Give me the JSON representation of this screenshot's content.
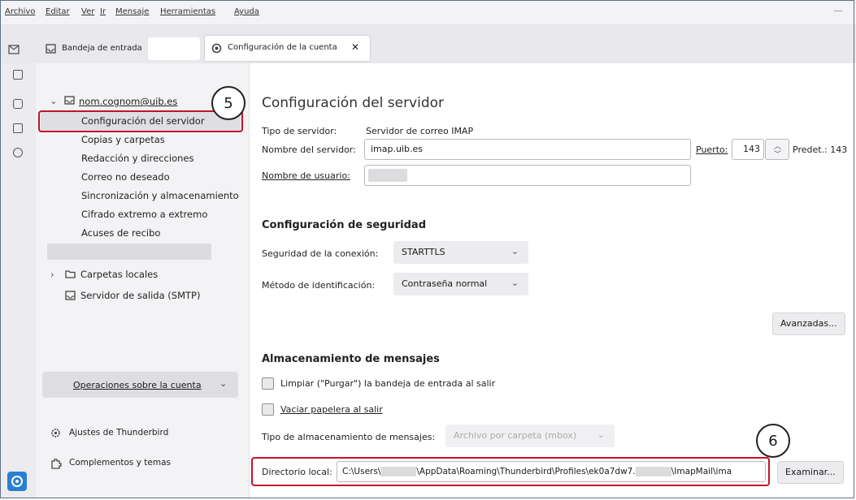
{
  "menu": [
    "Archivo",
    "Editar",
    "Ver",
    "Ir",
    "Mensaje",
    "Herramientas",
    "Ayuda"
  ],
  "window_control": "—",
  "tabs": [
    {
      "label": "Bandeja de entrada"
    },
    {
      "label": "Configuración de la cuenta",
      "close": "✕"
    }
  ],
  "sidebar": {
    "account": "nom.cognom@uib.es",
    "items": [
      "Configuración del servidor",
      "Copias y carpetas",
      "Redacción y direcciones",
      "Correo no deseado",
      "Sincronización y almacenamiento",
      "Cifrado extremo a extremo",
      "Acuses de recibo"
    ],
    "local_folders": "Carpetas locales",
    "smtp": "Servidor de salida (SMTP)",
    "account_actions": "Operaciones sobre la cuenta",
    "settings": "Ajustes de Thunderbird",
    "addons": "Complementos y temas"
  },
  "annotations": {
    "five": "5",
    "six": "6"
  },
  "main": {
    "title": "Configuración del servidor",
    "server_type_label": "Tipo de servidor:",
    "server_type_value": "Servidor de correo IMAP",
    "server_name_label": "Nombre del servidor:",
    "server_name_value": "imap.uib.es",
    "port_label": "Puerto:",
    "port_value": "143",
    "default_port": "Predet.: 143",
    "username_label": "Nombre de usuario:",
    "security_title": "Configuración de seguridad",
    "conn_security_label": "Seguridad de la conexión:",
    "conn_security_value": "STARTTLS",
    "auth_label": "Método de identificación:",
    "auth_value": "Contraseña normal",
    "advanced_button": "Avanzadas...",
    "storage_title": "Almacenamiento de mensajes",
    "purge_label": "Limpiar (\"Purgar\") la bandeja de entrada al salir",
    "empty_trash_label": "Vaciar papelera al salir",
    "store_type_label": "Tipo de almacenamiento de mensajes:",
    "store_type_value": "Archivo por carpeta (mbox)",
    "local_dir_label": "Directorio local:",
    "local_dir_seg1": "C:\\Users\\",
    "local_dir_seg2": "\\AppData\\Roaming\\Thunderbird\\Profiles\\ek0a7dw7.",
    "local_dir_seg3": "\\ImapMail\\ima",
    "browse_button": "Examinar..."
  },
  "colors": {
    "accent": "#c0142c",
    "sidebar_bg": "#f3f3f5",
    "selected": "#dfdfe3",
    "app_icon": "#2a7fd4"
  }
}
